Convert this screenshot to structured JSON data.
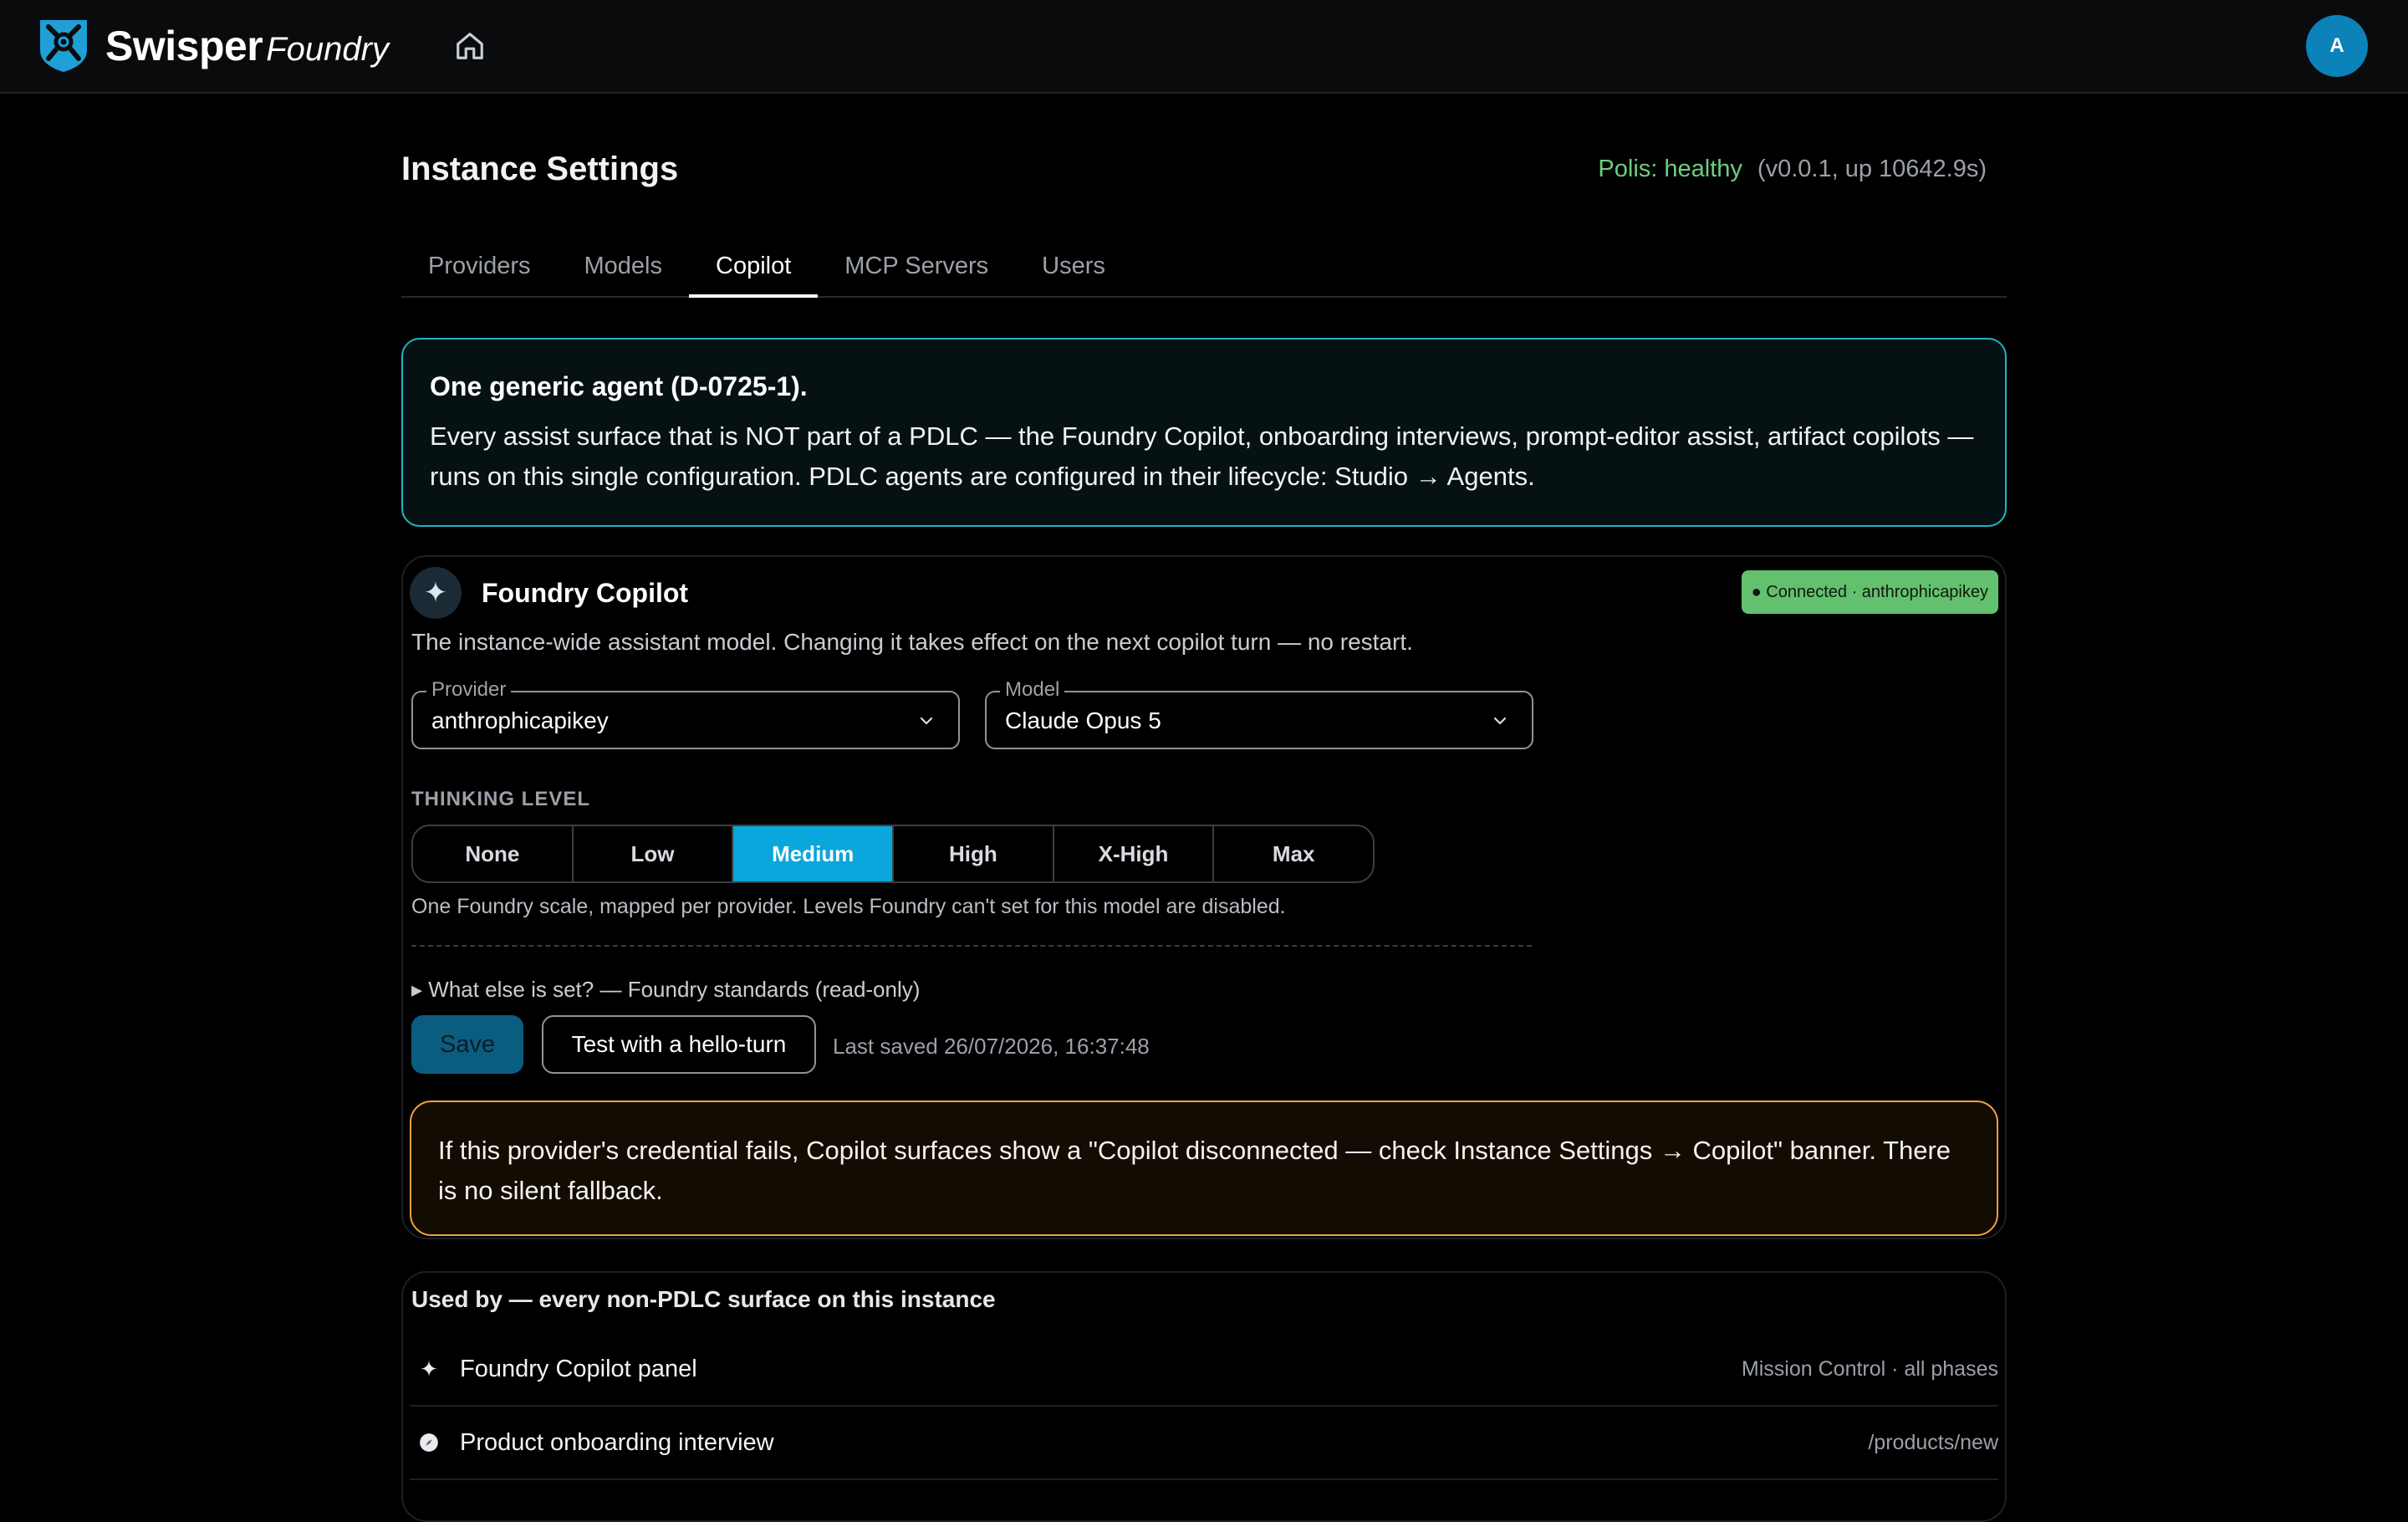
{
  "header": {
    "brand_main": "Swisper",
    "brand_sub": "Foundry",
    "avatar_initial": "A"
  },
  "page": {
    "title": "Instance Settings",
    "health_status": "Polis: healthy",
    "health_version": "(v0.0.1, up 10642.9s)"
  },
  "tabs": [
    {
      "label": "Providers",
      "active": false
    },
    {
      "label": "Models",
      "active": false
    },
    {
      "label": "Copilot",
      "active": true
    },
    {
      "label": "MCP Servers",
      "active": false
    },
    {
      "label": "Users",
      "active": false
    }
  ],
  "info_banner": {
    "title": "One generic agent (D-0725-1).",
    "body": "Every assist surface that is NOT part of a PDLC — the Foundry Copilot, onboarding interviews, prompt-editor assist, artifact copilots — runs on this single configuration. PDLC agents are configured in their lifecycle: Studio → Agents."
  },
  "copilot": {
    "title": "Foundry Copilot",
    "status_badge": "● Connected · anthrophicapikey",
    "description": "The instance-wide assistant model. Changing it takes effect on the next copilot turn — no restart.",
    "provider_label": "Provider",
    "provider_value": "anthrophicapikey",
    "model_label": "Model",
    "model_value": "Claude Opus 5",
    "thinking_label": "THINKING LEVEL",
    "thinking_options": [
      "None",
      "Low",
      "Medium",
      "High",
      "X-High",
      "Max"
    ],
    "thinking_selected": "Medium",
    "thinking_help": "One Foundry scale, mapped per provider. Levels Foundry can't set for this model are disabled.",
    "details_summary": "▸ What else is set? — Foundry standards (read-only)",
    "save_label": "Save",
    "test_label": "Test with a hello-turn",
    "last_saved": "Last saved 26/07/2026, 16:37:48",
    "warning": "If this provider's credential fails, Copilot surfaces show a \"Copilot disconnected — check Instance Settings → Copilot\" banner. There is no silent fallback."
  },
  "used_by": {
    "title": "Used by — every non-PDLC surface on this instance",
    "rows": [
      {
        "icon": "sparkle-icon",
        "label": "Foundry Copilot panel",
        "meta": "Mission Control · all phases"
      },
      {
        "icon": "compass-icon",
        "label": "Product onboarding interview",
        "meta": "/products/new"
      }
    ]
  },
  "colors": {
    "accent": "#0aa6dc",
    "info_border": "#23b3c2",
    "warning_border": "#f0a13c",
    "healthy": "#6fce7f",
    "connected_badge": "#63c06e"
  }
}
